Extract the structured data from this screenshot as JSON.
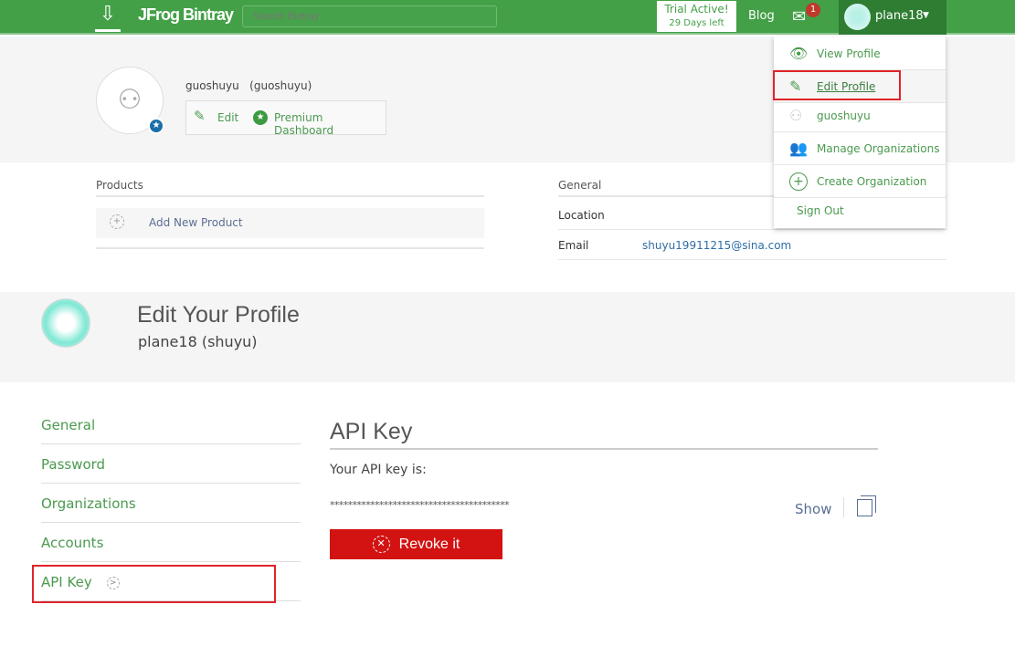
{
  "header": {
    "brand": "JFrog Bintray",
    "search_placeholder": "Search Bintray",
    "trial_title": "Trial Active!",
    "trial_days": "29 Days left",
    "blog": "Blog",
    "mail_count": "1",
    "username": "plane18"
  },
  "org": {
    "name": "guoshuyu   (guoshuyu)",
    "edit": "Edit",
    "premium": "Premium Dashboard"
  },
  "products": {
    "heading": "Products",
    "add": "Add New Product"
  },
  "general": {
    "heading": "General",
    "location_label": "Location",
    "email_label": "Email",
    "email": "shuyu19911215@sina.com"
  },
  "user_menu": {
    "items": [
      "View Profile",
      "Edit Profile",
      "guoshuyu",
      "Manage Organizations",
      "Create Organization",
      "Sign Out"
    ]
  },
  "edit_profile": {
    "title": "Edit Your Profile",
    "subtitle": "plane18 (shuyu)"
  },
  "side_nav": {
    "items": [
      "General",
      "Password",
      "Organizations",
      "Accounts",
      "API Key"
    ]
  },
  "api": {
    "title": "API Key",
    "label": "Your API key is:",
    "masked": "****************************************",
    "show": "Show",
    "revoke": "Revoke it"
  },
  "colors": {
    "brand_green": "#43a047",
    "revoke_red": "#d31212",
    "highlight": "#e0242a"
  }
}
